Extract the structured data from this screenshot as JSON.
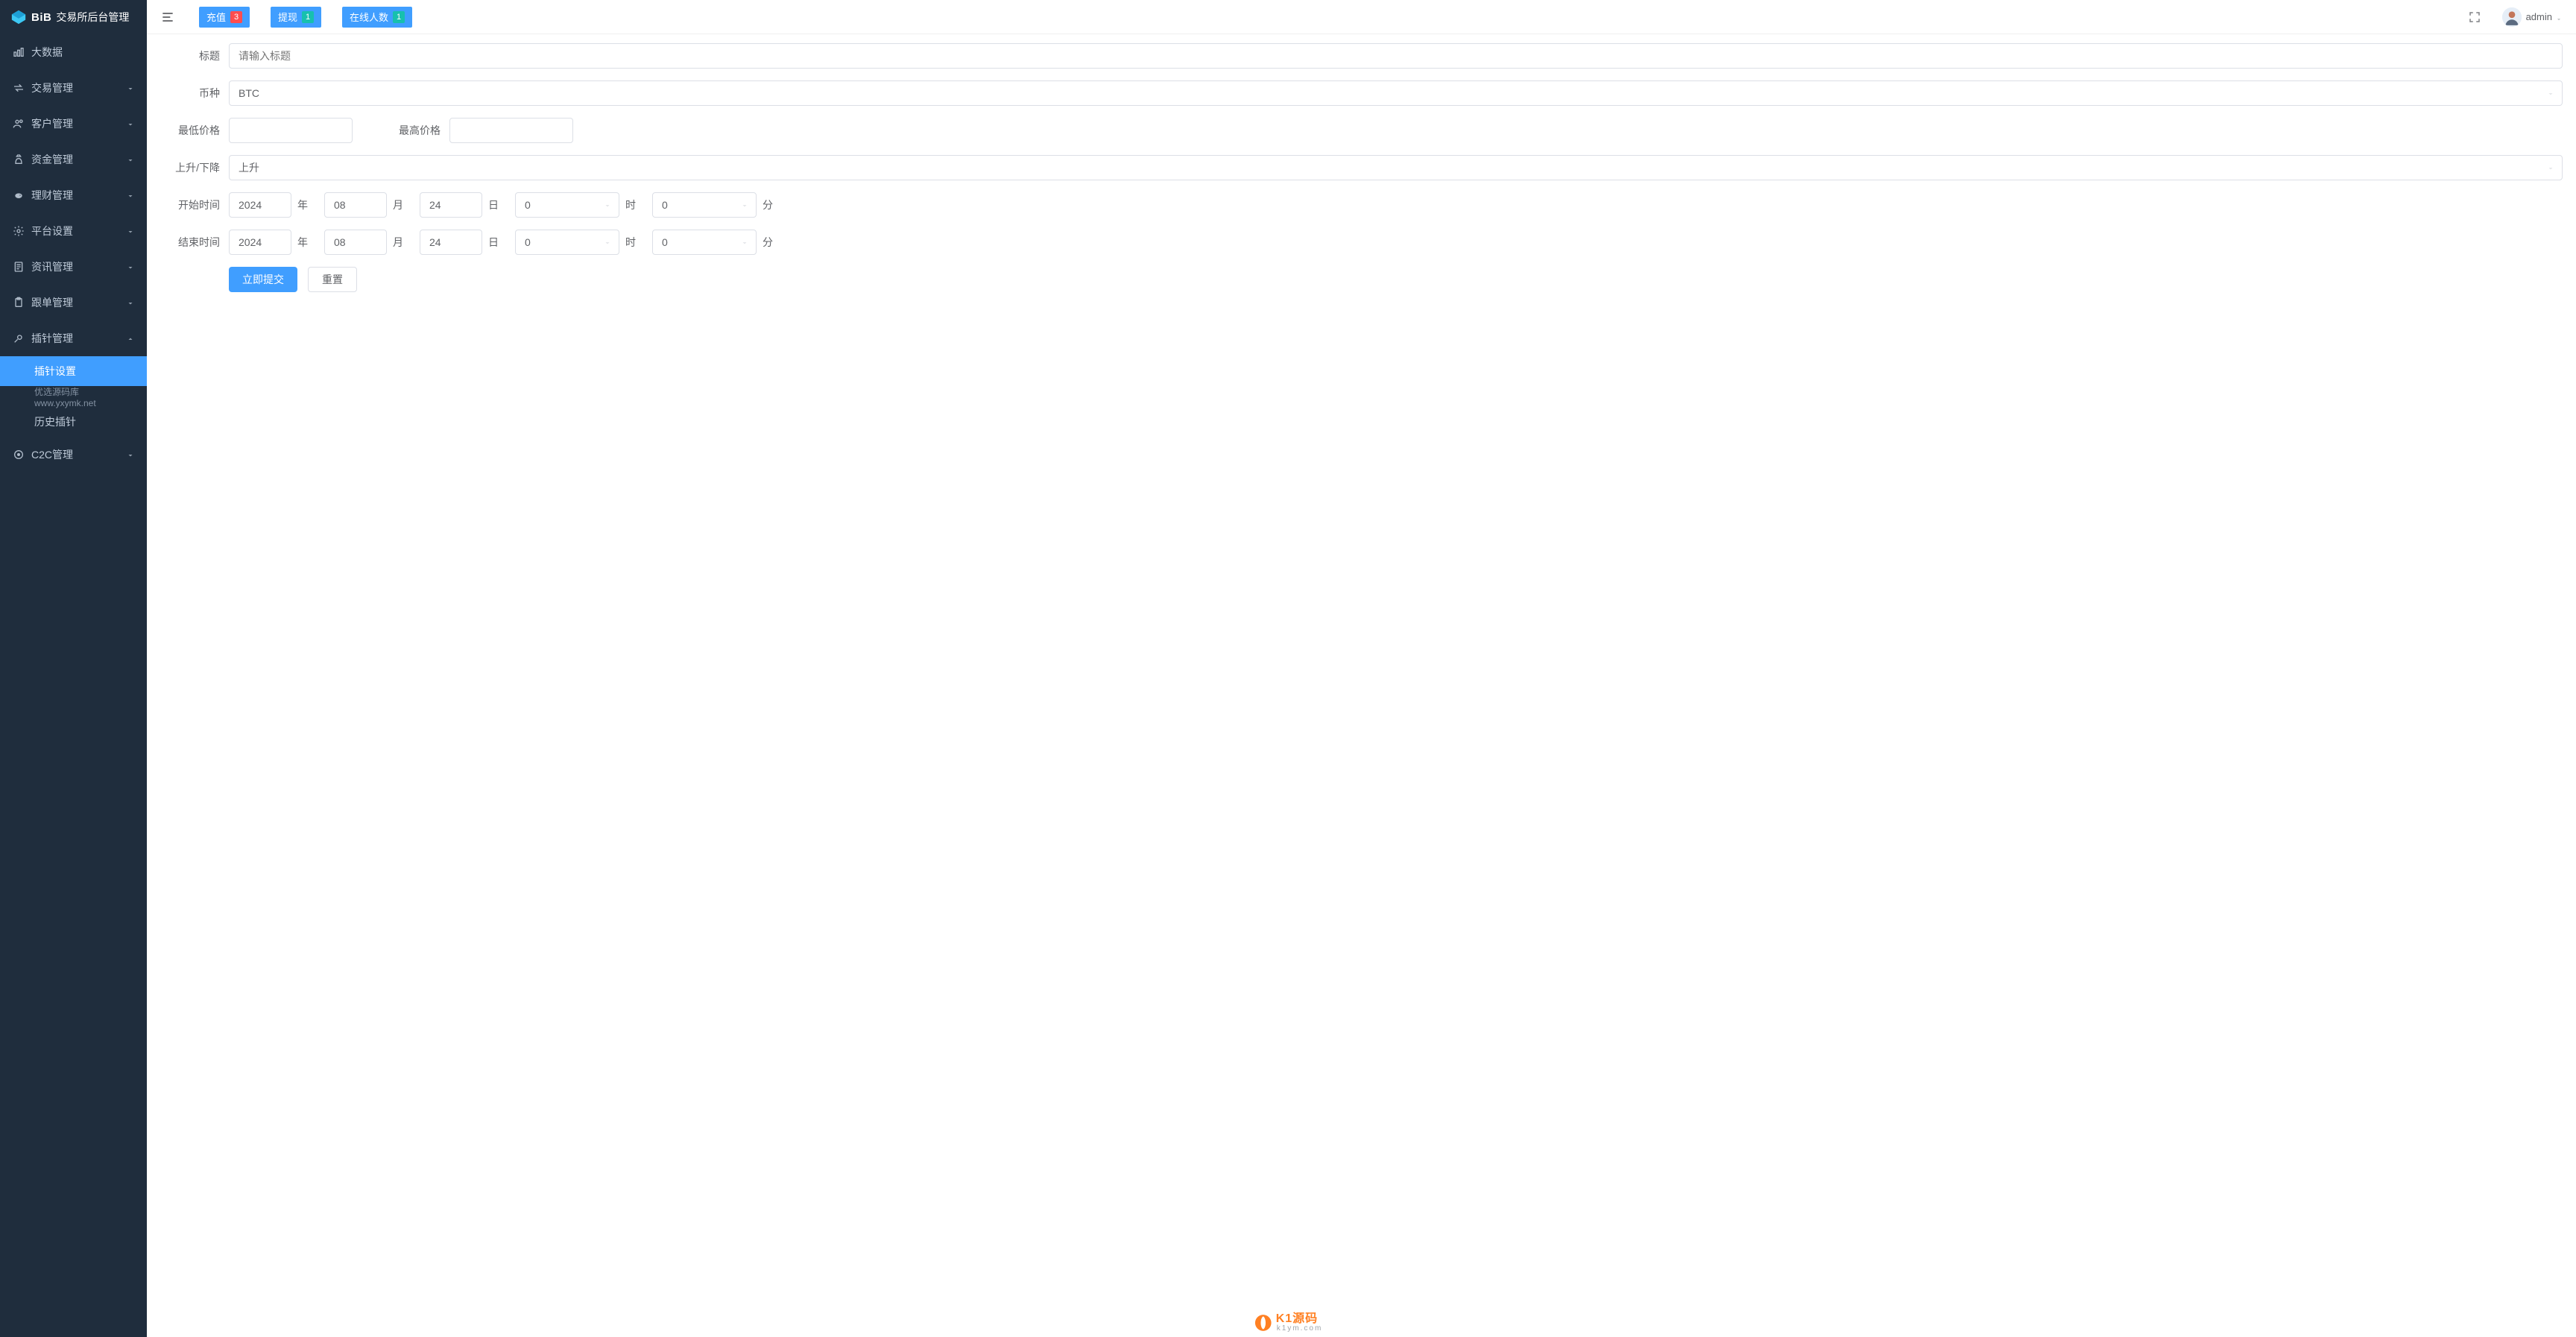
{
  "brand": {
    "logo_text": "BiB",
    "app_title": "交易所后台管理"
  },
  "sidebar": {
    "items": [
      {
        "label": "大数据",
        "expandable": false
      },
      {
        "label": "交易管理",
        "expandable": true
      },
      {
        "label": "客户管理",
        "expandable": true
      },
      {
        "label": "资金管理",
        "expandable": true
      },
      {
        "label": "理财管理",
        "expandable": true
      },
      {
        "label": "平台设置",
        "expandable": true
      },
      {
        "label": "资讯管理",
        "expandable": true
      },
      {
        "label": "跟单管理",
        "expandable": true
      },
      {
        "label": "插针管理",
        "expandable": true,
        "open": true
      },
      {
        "label": "C2C管理",
        "expandable": true
      }
    ],
    "pin_submenu": {
      "active": "插针设置",
      "note": "优选源码库  www.yxymk.net",
      "history": "历史插针"
    }
  },
  "topbar": {
    "buttons": [
      {
        "label": "充值",
        "count": "3",
        "count_style": "red"
      },
      {
        "label": "提现",
        "count": "1",
        "count_style": "teal"
      },
      {
        "label": "在线人数",
        "count": "1",
        "count_style": "teal"
      }
    ],
    "user_name": "admin"
  },
  "form": {
    "title_label": "标题",
    "title_placeholder": "请输入标题",
    "title_value": "",
    "coin_label": "币种",
    "coin_value": "BTC",
    "min_price_label": "最低价格",
    "min_price_value": "",
    "max_price_label": "最高价格",
    "max_price_value": "",
    "direction_label": "上升/下降",
    "direction_value": "上升",
    "start_label": "开始时间",
    "end_label": "结束时间",
    "units": {
      "year": "年",
      "month": "月",
      "day": "日",
      "hour": "时",
      "minute": "分"
    },
    "start": {
      "year": "2024",
      "month": "08",
      "day": "24",
      "hour": "0",
      "minute": "0"
    },
    "end": {
      "year": "2024",
      "month": "08",
      "day": "24",
      "hour": "0",
      "minute": "0"
    },
    "submit_label": "立即提交",
    "reset_label": "重置"
  },
  "watermark": {
    "main": "K1源码",
    "sub": "k1ym.com"
  }
}
